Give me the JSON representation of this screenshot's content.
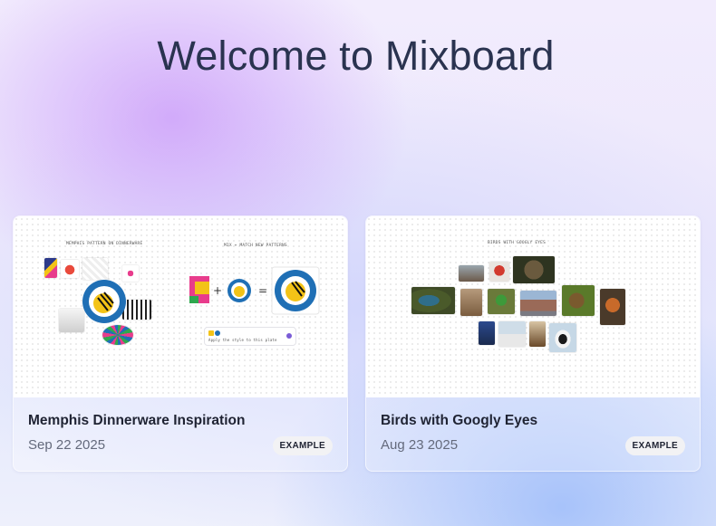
{
  "header": {
    "title": "Welcome to Mixboard"
  },
  "boards": [
    {
      "title": "Memphis Dinnerware Inspiration",
      "date": "Sep 22 2025",
      "badge": "EXAMPLE",
      "preview": {
        "caption_left": "MEMPHIS PATTERN ON DINNERWARE",
        "caption_right": "MIX + MATCH NEW PATTERNS",
        "prompt_text": "Apply the style to this plate",
        "colors": {
          "blue": "#1f6fb5",
          "yellow": "#f3c317",
          "pink": "#e83c8c",
          "green": "#2fa84f"
        }
      }
    },
    {
      "title": "Birds with Googly Eyes",
      "date": "Aug 23 2025",
      "badge": "EXAMPLE",
      "preview": {
        "caption": "BIRDS WITH GOOGLY EYES"
      }
    }
  ]
}
